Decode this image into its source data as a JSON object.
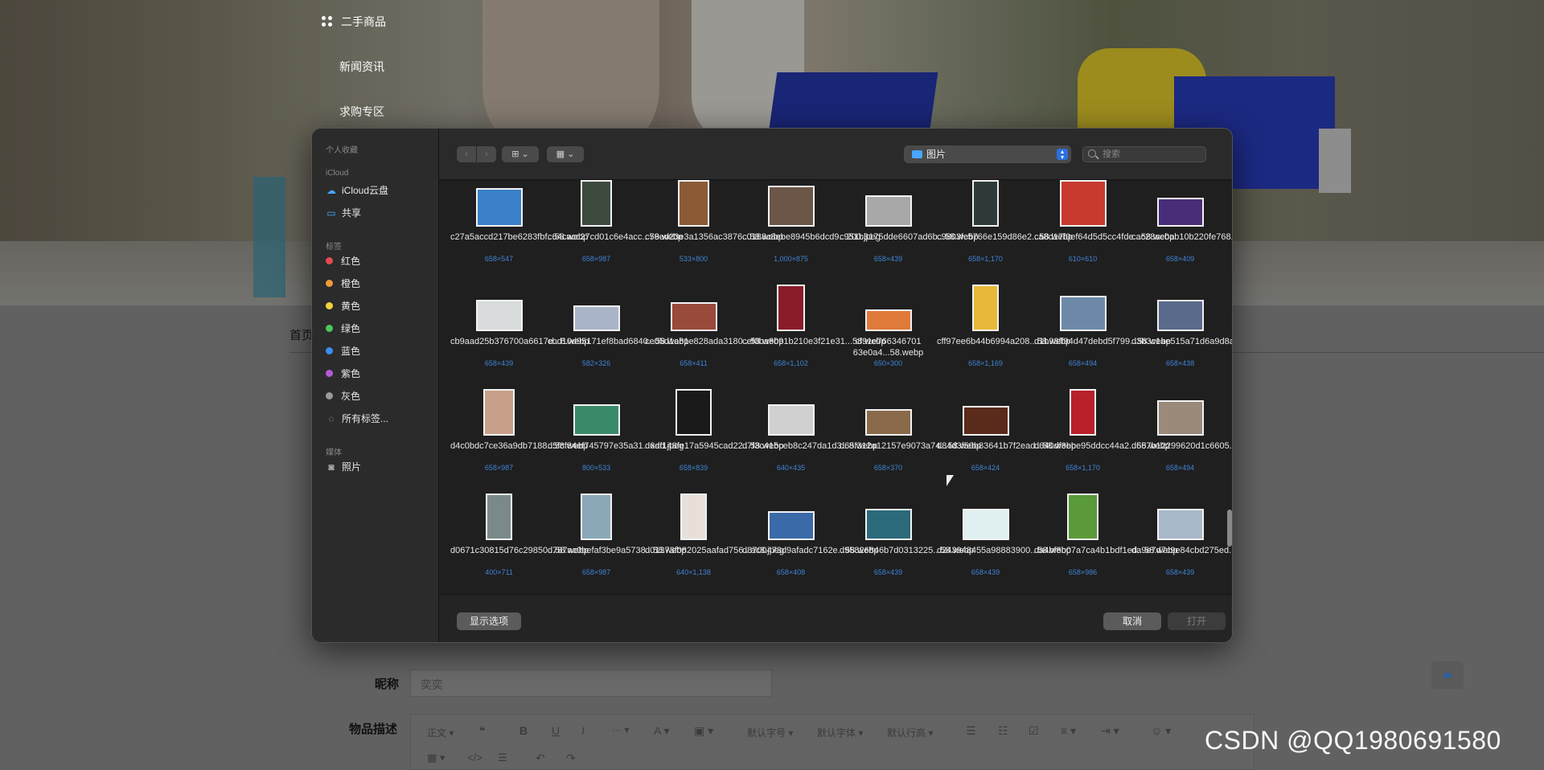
{
  "background_page": {
    "top_menu": [
      "二手商品",
      "新闻资讯",
      "求购专区"
    ],
    "nav_home": "首页",
    "form": {
      "nickname_label": "昵称",
      "nickname_value": "奕奕",
      "description_label": "物品描述"
    },
    "editor_toolbar": {
      "paragraph": "正文",
      "font_size": "默认字号",
      "font_family": "默认字体",
      "line_height": "默认行高"
    }
  },
  "dialog": {
    "sidebar": {
      "favorites_section": "个人收藏",
      "icloud_section": "iCloud",
      "icloud_items": [
        {
          "label": "iCloud云盘",
          "icon": "cloud-icon"
        },
        {
          "label": "共享",
          "icon": "shared-folder-icon"
        }
      ],
      "tags_section": "标签",
      "tags": [
        {
          "label": "红色",
          "color": "#e5484d"
        },
        {
          "label": "橙色",
          "color": "#f09a37"
        },
        {
          "label": "黄色",
          "color": "#f5d23b"
        },
        {
          "label": "绿色",
          "color": "#4cc75a"
        },
        {
          "label": "蓝色",
          "color": "#3d8cf0"
        },
        {
          "label": "紫色",
          "color": "#b45ad6"
        },
        {
          "label": "灰色",
          "color": "#9a9a9a"
        }
      ],
      "all_tags": "所有标签...",
      "media_section": "媒体",
      "media_items": [
        {
          "label": "照片",
          "icon": "camera-icon"
        }
      ]
    },
    "toolbar": {
      "back_icon": "chevron-left-icon",
      "forward_icon": "chevron-right-icon",
      "location": "图片",
      "search_placeholder": "搜索"
    },
    "files": [
      {
        "name": "c27a5accd217be6283fbf...58.webp",
        "dims": "658×547",
        "thumb": "#3a7fc8"
      },
      {
        "name": "c64cacc27cd01c6e4acc...58.webp",
        "dims": "658×987",
        "thumb": "#3d4a3e"
      },
      {
        "name": "c79ed23e3a1356ac3876...58.webp",
        "dims": "533×800",
        "thumb": "#8a5a35"
      },
      {
        "name": "c0188c8ebe8945b6dcd9...200.jpeg",
        "dims": "1,000×875",
        "thumb": "#6b5648"
      },
      {
        "name": "c951b3175dde6607ad6b...58.webp",
        "dims": "658×439",
        "thumb": "#a8a8a8"
      },
      {
        "name": "c9803fc5766e159d86e2...58.webp",
        "dims": "658×1,170",
        "thumb": "#2e3a3a"
      },
      {
        "name": "ca8d17f0ef64d5d5cc4fde...58.webp",
        "dims": "610×610",
        "thumb": "#c83a2e"
      },
      {
        "name": "cac28ac0ab10b220fe768...58.webp",
        "dims": "658×409",
        "thumb": "#4a2d78"
      },
      {
        "name": "cb9aad25b376700a6617e...8.webp",
        "dims": "658×439",
        "thumb": "#d8dcdc"
      },
      {
        "name": "cbd10d95171ef8bad6840...58.webp",
        "dims": "582×326",
        "thumb": "#a9b4c8"
      },
      {
        "name": "ce05d1a81e828ada3180...58.webp",
        "dims": "658×411",
        "thumb": "#9a4a3a"
      },
      {
        "name": "cef0ba8091b210e3f21e31...58.webp",
        "dims": "658×1,102",
        "thumb": "#8a1c2a"
      },
      {
        "name": "cf91e766346701 63e0a4...58.webp",
        "dims": "650×300",
        "thumb": "#e07a3a"
      },
      {
        "name": "cff97ee6b44b6994a208...58.webp",
        "dims": "658×1,169",
        "thumb": "#e8b83a"
      },
      {
        "name": "d1b98ff94d47debd5f799...58.webp",
        "dims": "658×494",
        "thumb": "#6c8aa8"
      },
      {
        "name": "d3b3c1ae515a71d6a9d8a...58.webp",
        "dims": "658×438",
        "thumb": "#5a6a8a"
      },
      {
        "name": "d4c0bdc7ce36a9db7188...58.webp",
        "dims": "658×987",
        "thumb": "#c8a08a"
      },
      {
        "name": "d5fcf84ef745797e35a31...xdd.jpeg",
        "dims": "800×533",
        "thumb": "#3a8a6a"
      },
      {
        "name": "d6af148fe17a5945cad22...58.webp",
        "dims": "658×839",
        "thumb": "#1a1a1a"
      },
      {
        "name": "d7f3c415ceb8c247da1d3...8.webp",
        "dims": "640×435",
        "thumb": "#d0d0d0"
      },
      {
        "name": "d65f312a12157e9073a74...58.webp",
        "dims": "658×370",
        "thumb": "#8a6a4a"
      },
      {
        "name": "d84d3f50b83641b7f2ead...58.webp",
        "dims": "658×424",
        "thumb": "#5a2a1a"
      },
      {
        "name": "d640df3ebe95ddcc44a2...58.webp",
        "dims": "658×1,170",
        "thumb": "#b8202a"
      },
      {
        "name": "d657b12299620d1c6605...58.webp",
        "dims": "658×494",
        "thumb": "#9a8a7a"
      },
      {
        "name": "d0671c30815d76c29850...58.webp",
        "dims": "400×711",
        "thumb": "#7a8a8a"
      },
      {
        "name": "d787ac0befaf3be9a5738...58.webp",
        "dims": "658×987",
        "thumb": "#8aa8b8"
      },
      {
        "name": "d01373f082025aafad756...ac8.jpeg",
        "dims": "640×1,138",
        "thumb": "#e8e0d8"
      },
      {
        "name": "d8700473d9afadc7162e...58.webp",
        "dims": "658×408",
        "thumb": "#3a6aa8"
      },
      {
        "name": "d95826846b7d0313225...58.webp",
        "dims": "658×439",
        "thumb": "#2a6a7a"
      },
      {
        "name": "d243948455a98883900...58.webp",
        "dims": "658×439",
        "thumb": "#e0f0f0"
      },
      {
        "name": "da4bf8b07a7ca4b1bdf1ed...58.webp",
        "dims": "658×986",
        "thumb": "#5a9a3a"
      },
      {
        "name": "da9e7d7c9e84cbd275ed...58.webp",
        "dims": "658×439",
        "thumb": "#a8b8c8"
      }
    ],
    "footer": {
      "show_options": "显示选项",
      "cancel": "取消",
      "open": "打开"
    }
  },
  "watermark": "CSDN @QQ1980691580"
}
